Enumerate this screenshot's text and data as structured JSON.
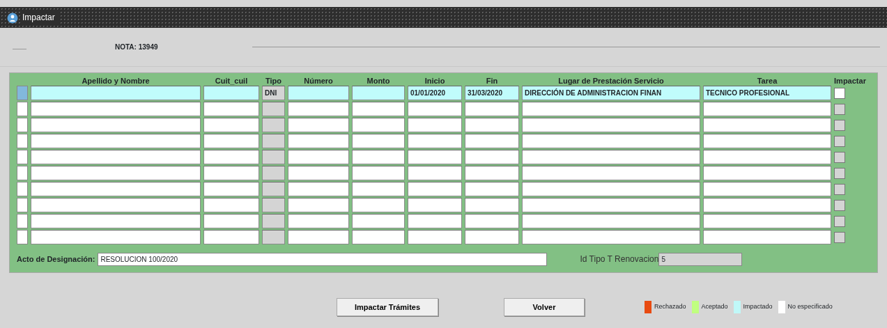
{
  "window": {
    "title": "Impactar"
  },
  "nota": "NOTA: 13949",
  "table": {
    "columns": [
      "Apellido y Nombre",
      "Cuit_cuil",
      "Tipo",
      "Número",
      "Monto",
      "Inicio",
      "Fin",
      "Lugar de Prestación Servicio",
      "Tarea",
      "Impactar"
    ],
    "rows": [
      {
        "selected": true,
        "checked": false,
        "disabled": false,
        "tipo": "DNI",
        "inicio": "01/01/2020",
        "fin": "31/03/2020",
        "lugar": "DIRECCIÓN DE ADMINISTRACION FINAN",
        "tarea": "TECNICO PROFESIONAL"
      },
      {
        "selected": false,
        "checked": false,
        "disabled": true
      },
      {
        "selected": false,
        "checked": false,
        "disabled": true
      },
      {
        "selected": false,
        "checked": false,
        "disabled": true
      },
      {
        "selected": false,
        "checked": false,
        "disabled": true
      },
      {
        "selected": false,
        "checked": false,
        "disabled": true
      },
      {
        "selected": false,
        "checked": false,
        "disabled": true
      },
      {
        "selected": false,
        "checked": false,
        "disabled": true
      },
      {
        "selected": false,
        "checked": false,
        "disabled": true
      },
      {
        "selected": false,
        "checked": false,
        "disabled": true
      }
    ]
  },
  "acto": {
    "label": "Acto de Designación:",
    "value": "RESOLUCION 100/2020"
  },
  "renovacion": {
    "label": "Id Tipo T Renovacion",
    "value": "5"
  },
  "buttons": [
    "Impactar Trámites",
    "Volver"
  ],
  "legend": [
    {
      "label": "Rechazado",
      "color": "#e84a10"
    },
    {
      "label": "Aceptado",
      "color": "#c0ff80"
    },
    {
      "label": "Impactado",
      "color": "#c0f8f8"
    },
    {
      "label": "No especificado",
      "color": "#ffffff"
    }
  ]
}
